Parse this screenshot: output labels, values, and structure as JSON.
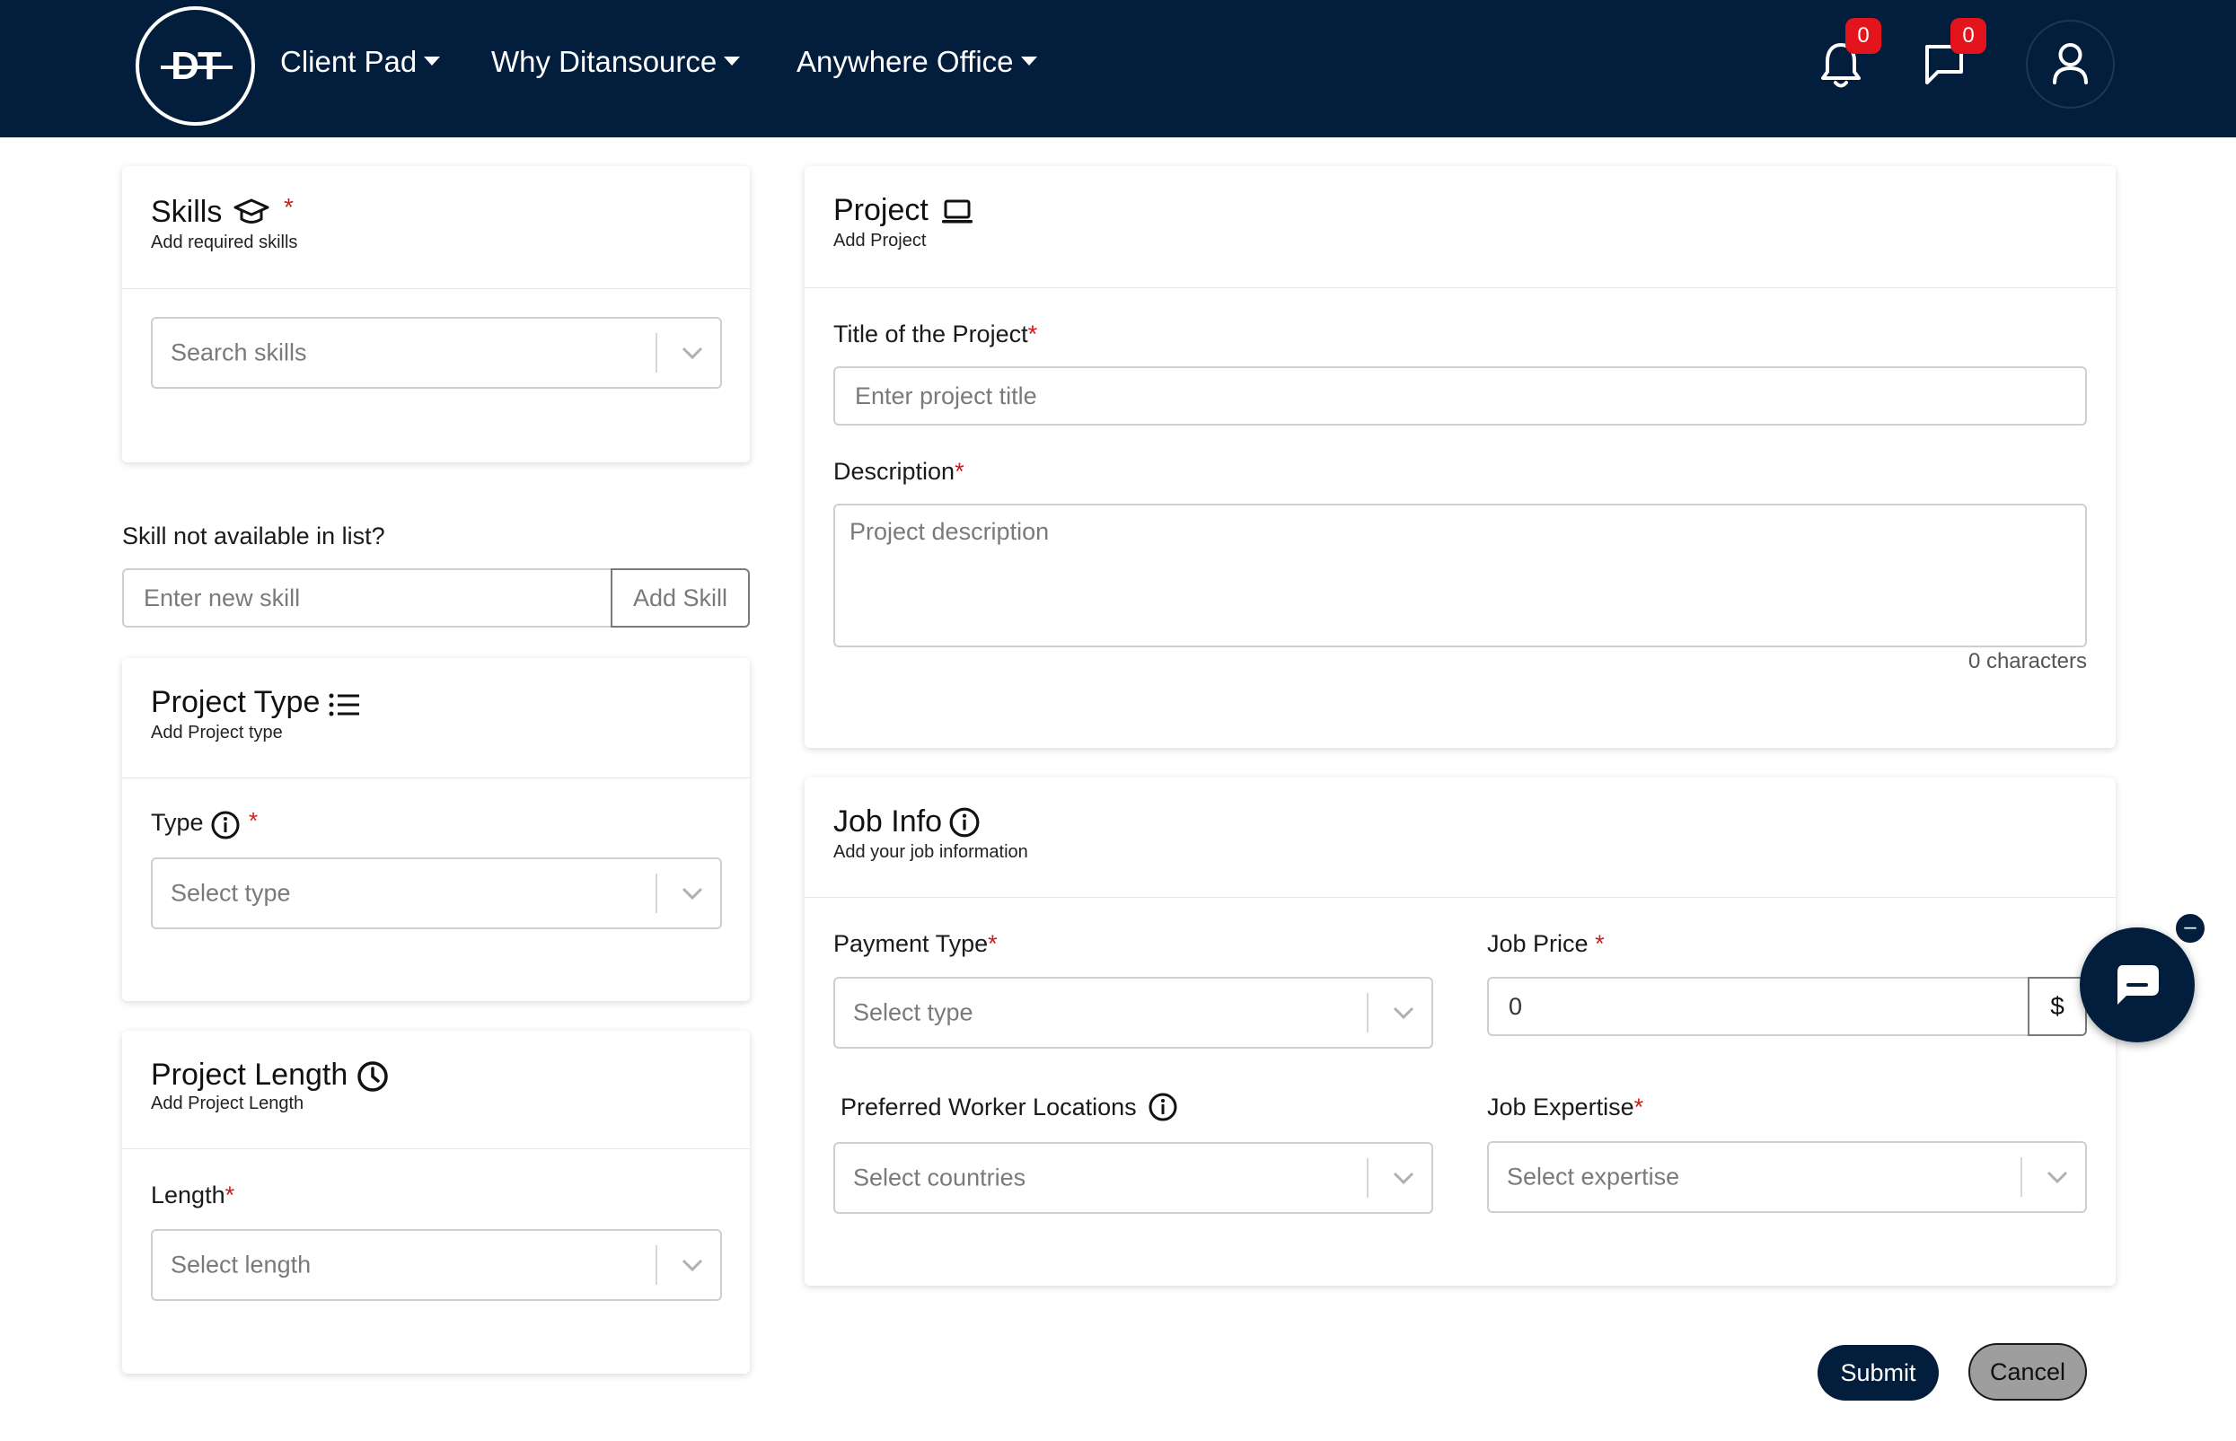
{
  "navbar": {
    "logo_text": "DT",
    "links": [
      {
        "label": "Client Pad"
      },
      {
        "label": "Why Ditansource"
      },
      {
        "label": "Anywhere Office"
      }
    ],
    "notifications_count": "0",
    "messages_count": "0",
    "colors": {
      "background": "#031e3d",
      "badge": "#e3141b"
    }
  },
  "skills": {
    "title": "Skills",
    "required_mark": "*",
    "subtitle": "Add required skills",
    "search_placeholder": "Search skills",
    "icon": "graduation-cap-icon"
  },
  "new_skill": {
    "label": "Skill not available in list?",
    "placeholder": "Enter new skill",
    "button_label": "Add Skill"
  },
  "project_type": {
    "title": "Project Type",
    "subtitle": "Add Project type",
    "type_label": "Type",
    "required_mark": "*",
    "select_placeholder": "Select type",
    "icon": "list-icon"
  },
  "project_length": {
    "title": "Project Length",
    "subtitle": "Add Project Length",
    "length_label": "Length",
    "required_mark": "*",
    "select_placeholder": "Select length",
    "icon": "clock-icon"
  },
  "project": {
    "title": "Project",
    "subtitle": "Add Project",
    "title_label": "Title of the Project",
    "title_placeholder": "Enter project title",
    "description_label": "Description",
    "description_placeholder": "Project description",
    "char_count": "0 characters",
    "required_mark": "*",
    "icon": "laptop-icon"
  },
  "job_info": {
    "title": "Job Info",
    "subtitle": "Add your job information",
    "payment_type_label": "Payment Type",
    "payment_type_placeholder": "Select type",
    "job_price_label": "Job Price",
    "job_price_value": "0",
    "currency": "$",
    "locations_label": "Preferred Worker Locations",
    "locations_placeholder": "Select countries",
    "expertise_label": "Job Expertise",
    "expertise_placeholder": "Select expertise",
    "required_mark": "*"
  },
  "actions": {
    "submit_label": "Submit",
    "cancel_label": "Cancel",
    "colors": {
      "submit": "#031e3d",
      "cancel": "#9e9e9e"
    }
  },
  "chat_widget": {
    "minimize_glyph": "–"
  }
}
